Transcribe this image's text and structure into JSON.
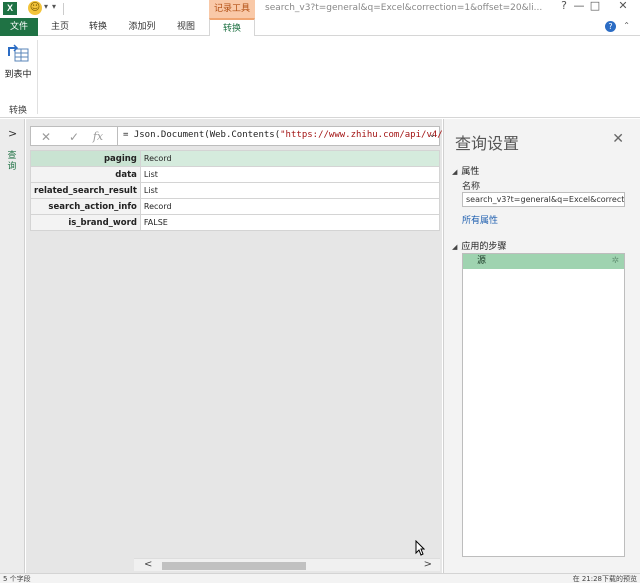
{
  "titlebar": {
    "app_icon": "X",
    "tool_context": "记录工具",
    "window_title": "search_v3?t=general&q=Excel&correction=1&offset=20&li...",
    "win_buttons": [
      "?",
      "—",
      "□",
      "✕"
    ]
  },
  "tabs": [
    {
      "label": "文件"
    },
    {
      "label": "主页"
    },
    {
      "label": "转换"
    },
    {
      "label": "添加列"
    },
    {
      "label": "视图"
    },
    {
      "label": "转换"
    }
  ],
  "ribbon": {
    "to_table_label": "到表中",
    "group_label": "转换"
  },
  "leftnav": {
    "label": "查询"
  },
  "formula_bar": {
    "fx": "fx",
    "prefix": "= Json.Document(Web.Contents(",
    "string": "\"https://www.zhihu.com/api/v4/"
  },
  "records": [
    {
      "key": "paging",
      "value": "Record"
    },
    {
      "key": "data",
      "value": "List"
    },
    {
      "key": "related_search_result",
      "value": "List"
    },
    {
      "key": "search_action_info",
      "value": "Record"
    },
    {
      "key": "is_brand_word",
      "value": "FALSE"
    }
  ],
  "settings": {
    "title": "查询设置",
    "properties_header": "属性",
    "name_label": "名称",
    "name_value": "search_v3?t=general&q=Excel&correction",
    "all_properties_link": "所有属性",
    "steps_header": "应用的步骤",
    "steps": [
      {
        "label": "源"
      }
    ]
  },
  "status": {
    "left": "5 个字段",
    "right": "在 21:28下载的预览"
  },
  "colors": {
    "excel_green": "#1f7244",
    "context_orange": "#f9c9a8",
    "step_selected": "#9fd3b0",
    "row_selected": "#d5ebdd"
  }
}
